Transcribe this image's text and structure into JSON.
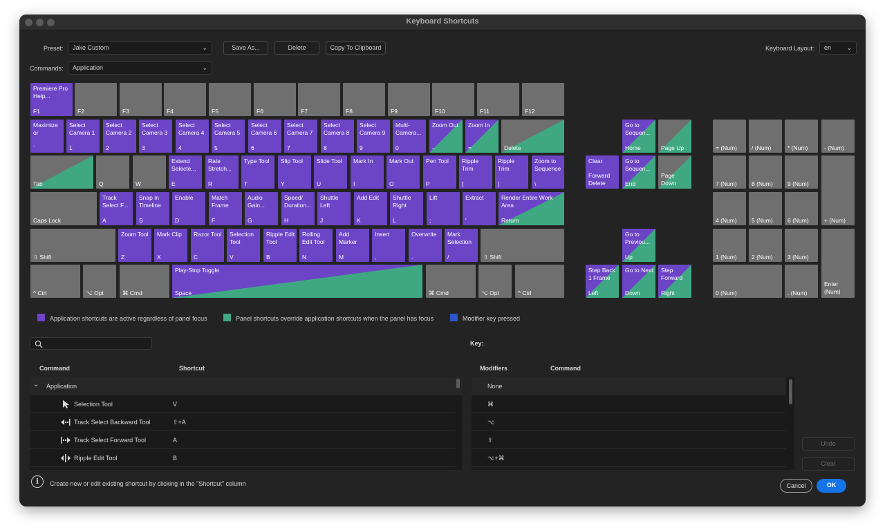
{
  "window": {
    "title": "Keyboard Shortcuts"
  },
  "toolbar": {
    "preset_label": "Preset:",
    "preset_value": "Jake Custom",
    "save_as": "Save As...",
    "delete": "Delete",
    "copy": "Copy To Clipboard",
    "layout_label": "Keyboard Layout:",
    "layout_value": "en",
    "commands_label": "Commands:",
    "commands_value": "Application"
  },
  "keys": {
    "f1_cmd": "Premiere Pro Help...",
    "f1": "F1",
    "f2": "F2",
    "f3": "F3",
    "f4": "F4",
    "f5": "F5",
    "f6": "F6",
    "f7": "F7",
    "f8": "F8",
    "f9": "F9",
    "f10": "F10",
    "f11": "F11",
    "f12": "F12",
    "grave_cmd": "Maximize or",
    "grave": "`",
    "k1_cmd": "Select Camera 1",
    "k1": "1",
    "k2_cmd": "Select Camera 2",
    "k2": "2",
    "k3_cmd": "Select Camera 3",
    "k3": "3",
    "k4_cmd": "Select Camera 4",
    "k4": "4",
    "k5_cmd": "Select Camera 5",
    "k5": "5",
    "k6_cmd": "Select Camera 6",
    "k6": "6",
    "k7_cmd": "Select Camera 7",
    "k7": "7",
    "k8_cmd": "Select Camera 8",
    "k8": "8",
    "k9_cmd": "Select Camera 9",
    "k9": "9",
    "k0_cmd": "Multi-Camera...",
    "k0": "0",
    "minus_cmd": "Zoom Out",
    "minus": "-",
    "equal_cmd": "Zoom In",
    "equal": "=",
    "delete": "Delete",
    "tab": "Tab",
    "q": "Q",
    "w": "W",
    "e_cmd": "Extend Selecte...",
    "e": "E",
    "r_cmd": "Rate Stretch...",
    "r": "R",
    "t_cmd": "Type Tool",
    "t": "T",
    "y_cmd": "Slip Tool",
    "y": "Y",
    "u_cmd": "Slide Tool",
    "u": "U",
    "i_cmd": "Mark In",
    "i": "I",
    "o_cmd": "Mark Out",
    "o": "O",
    "p_cmd": "Pen Tool",
    "p": "P",
    "lb_cmd": "Ripple Trim",
    "lb": "[",
    "rb_cmd": "Ripple Trim",
    "rb": "]",
    "bs_cmd": "Zoom to Sequence",
    "bs": "\\",
    "caps": "Caps Lock",
    "a_cmd": "Track Select F...",
    "a": "A",
    "s_cmd": "Snap in Timeline",
    "s": "S",
    "d_cmd": "Enable",
    "d": "D",
    "f_cmd": "Match Frame",
    "f": "F",
    "g_cmd": "Audio Gain...",
    "g": "G",
    "h_cmd": "Speed/ Duration...",
    "h": "H",
    "j_cmd": "Shuttle Left",
    "j": "J",
    "k_cmd": "Add Edit",
    "k": "K",
    "l_cmd": "Shuttle Right",
    "l": "L",
    "semi_cmd": "Lift",
    "semi": ";",
    "quote_cmd": "Extract",
    "quote": "'",
    "ret_cmd": "Render Entire Work Area",
    "ret": "Return",
    "lshift": "⇧ Shift",
    "z_cmd": "Zoom Tool",
    "z": "Z",
    "x_cmd": "Mark Clip",
    "x": "X",
    "c_cmd": "Razor Tool",
    "c": "C",
    "v_cmd": "Selection Tool",
    "v": "V",
    "b_cmd": "Ripple Edit Tool",
    "b": "B",
    "n_cmd": "Rolling Edit Tool",
    "n": "N",
    "m_cmd": "Add Marker",
    "m": "M",
    "comma_cmd": "Insert",
    "comma": ",",
    "period_cmd": "Overwrite",
    "period": ".",
    "slash_cmd": "Mark Selection",
    "slash": "/",
    "rshift": "⇧ Shift",
    "lctrl": "^ Ctrl",
    "lopt": "⌥ Opt",
    "lcmd": "⌘ Cmd",
    "space_cmd": "Play-Stop Toggle",
    "space": "Space",
    "rcmd": "⌘ Cmd",
    "ropt": "⌥ Opt",
    "rctrl": "^ Ctrl",
    "fdel_cmd": "Clear",
    "fdel": "Forward Delete",
    "home_cmd": "Go to Sequen...",
    "home": "Home",
    "pgup": "Page Up",
    "end_cmd": "Go to Sequen...",
    "end": "End",
    "pgdn": "Page Down",
    "up_cmd": "Go to Previou...",
    "up": "Up",
    "left_cmd": "Step Back 1 Frame",
    "left": "Left",
    "down_cmd": "Go to Next",
    "down": "Down",
    "right_cmd": "Step Forward",
    "right": "Right",
    "num_eq": "= (Num)",
    "num_div": "/ (Num)",
    "num_mul": "* (Num)",
    "num_sub": "- (Num)",
    "num7": "7 (Num)",
    "num8": "8 (Num)",
    "num9": "9 (Num)",
    "num_add": "+ (Num)",
    "num4": "4 (Num)",
    "num5": "5 (Num)",
    "num6": "6 (Num)",
    "num1": "1 (Num)",
    "num2": "2 (Num)",
    "num3": "3 (Num)",
    "num_enter": "Enter (Num)",
    "num0": "0 (Num)",
    "num_dot": ". (Num)"
  },
  "legend": {
    "app": "Application shortcuts are active regardless of panel focus",
    "panel": "Panel shortcuts override application shortcuts when the panel has focus",
    "modifier": "Modifier key pressed",
    "colors": {
      "app": "#6c45c6",
      "panel": "#3fa883",
      "modifier": "#2f55c9"
    }
  },
  "search": {
    "placeholder": ""
  },
  "table": {
    "col_command": "Command",
    "col_shortcut": "Shortcut",
    "group": "Application",
    "rows": [
      {
        "command": "Selection Tool",
        "shortcut": "V",
        "icon": "selection-arrow-icon"
      },
      {
        "command": "Track Select Backward Tool",
        "shortcut": "⇧+A",
        "icon": "track-select-backward-icon"
      },
      {
        "command": "Track Select Forward Tool",
        "shortcut": "A",
        "icon": "track-select-forward-icon"
      },
      {
        "command": "Ripple Edit Tool",
        "shortcut": "B",
        "icon": "ripple-edit-icon"
      }
    ]
  },
  "key_panel": {
    "title": "Key:",
    "col_modifiers": "Modifiers",
    "col_command": "Command",
    "rows": [
      {
        "modifiers": "None"
      },
      {
        "modifiers": "⌘"
      },
      {
        "modifiers": "⌥"
      },
      {
        "modifiers": "⇧"
      },
      {
        "modifiers": "⌥+⌘"
      }
    ]
  },
  "footer": {
    "info": "Create new or edit existing shortcut by clicking in the \"Shortcut\" column",
    "undo": "Undo",
    "clear": "Clear",
    "cancel": "Cancel",
    "ok": "OK"
  }
}
